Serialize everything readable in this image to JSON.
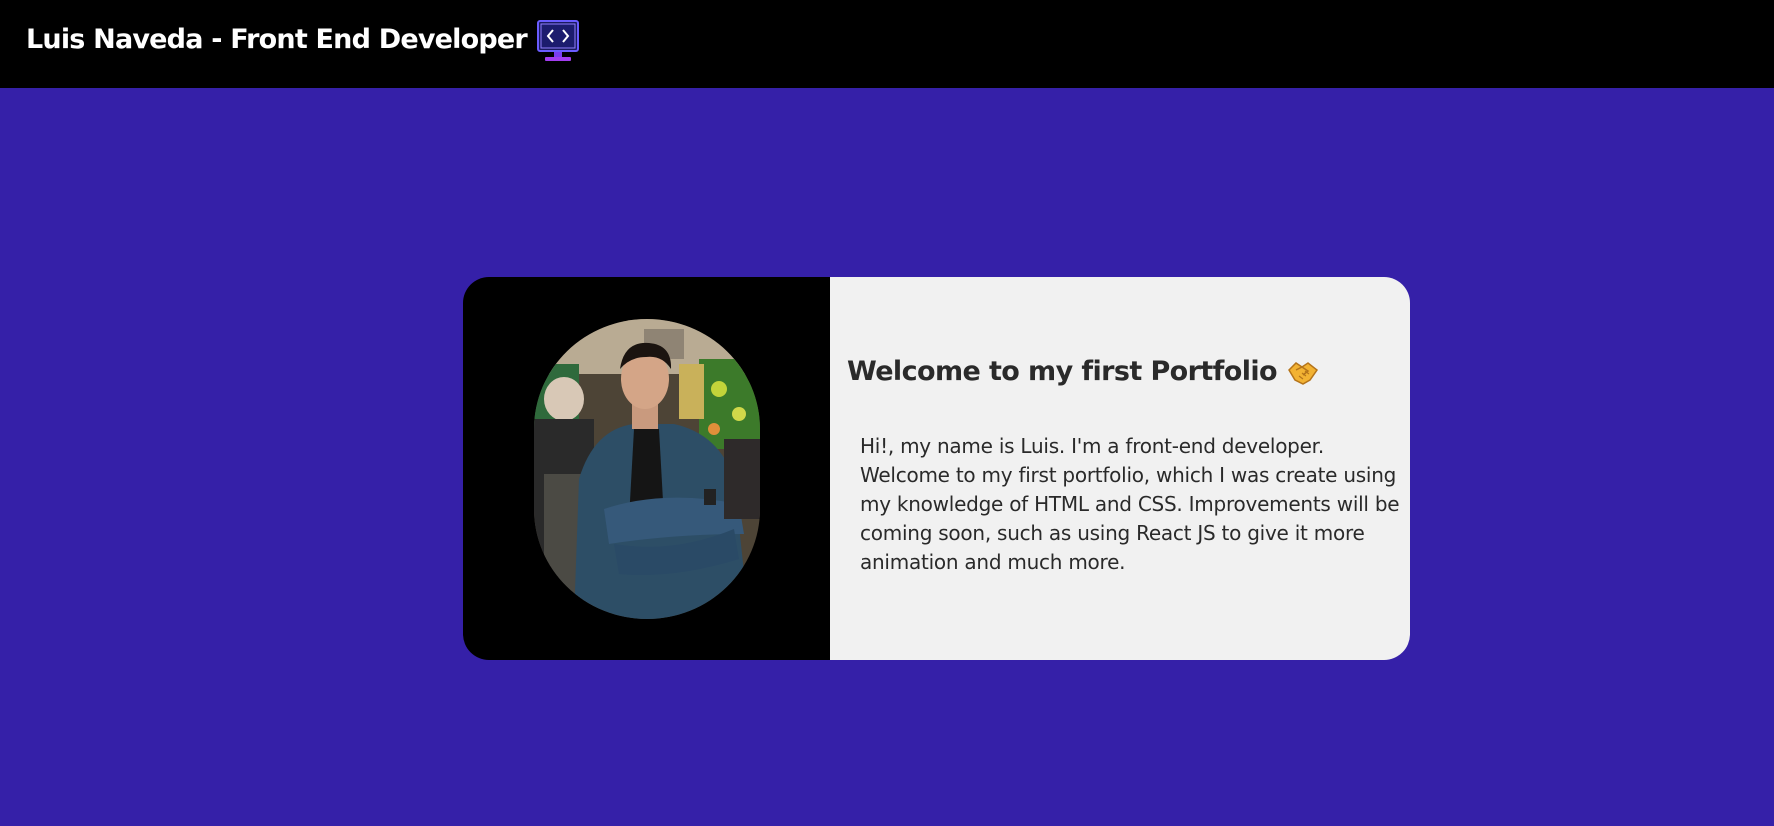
{
  "header": {
    "title": "Luis Naveda - Front End Developer",
    "icon": "developer-monitor-icon",
    "background": "#000000"
  },
  "page": {
    "background": "#3520a8"
  },
  "card": {
    "photo": {
      "icon": "profile-photo",
      "pane_color": "#000000"
    },
    "heading": "Welcome to my first Portfolio",
    "heading_icon": "handshake-icon",
    "bio": "Hi!, my name is Luis. I'm a front-end developer. Welcome to my first portfolio, which I was create using my knowledge of HTML and CSS. Improvements will be coming soon, such as using React JS to give it more animation and much more.",
    "text_pane_color": "#f1f1f1"
  }
}
